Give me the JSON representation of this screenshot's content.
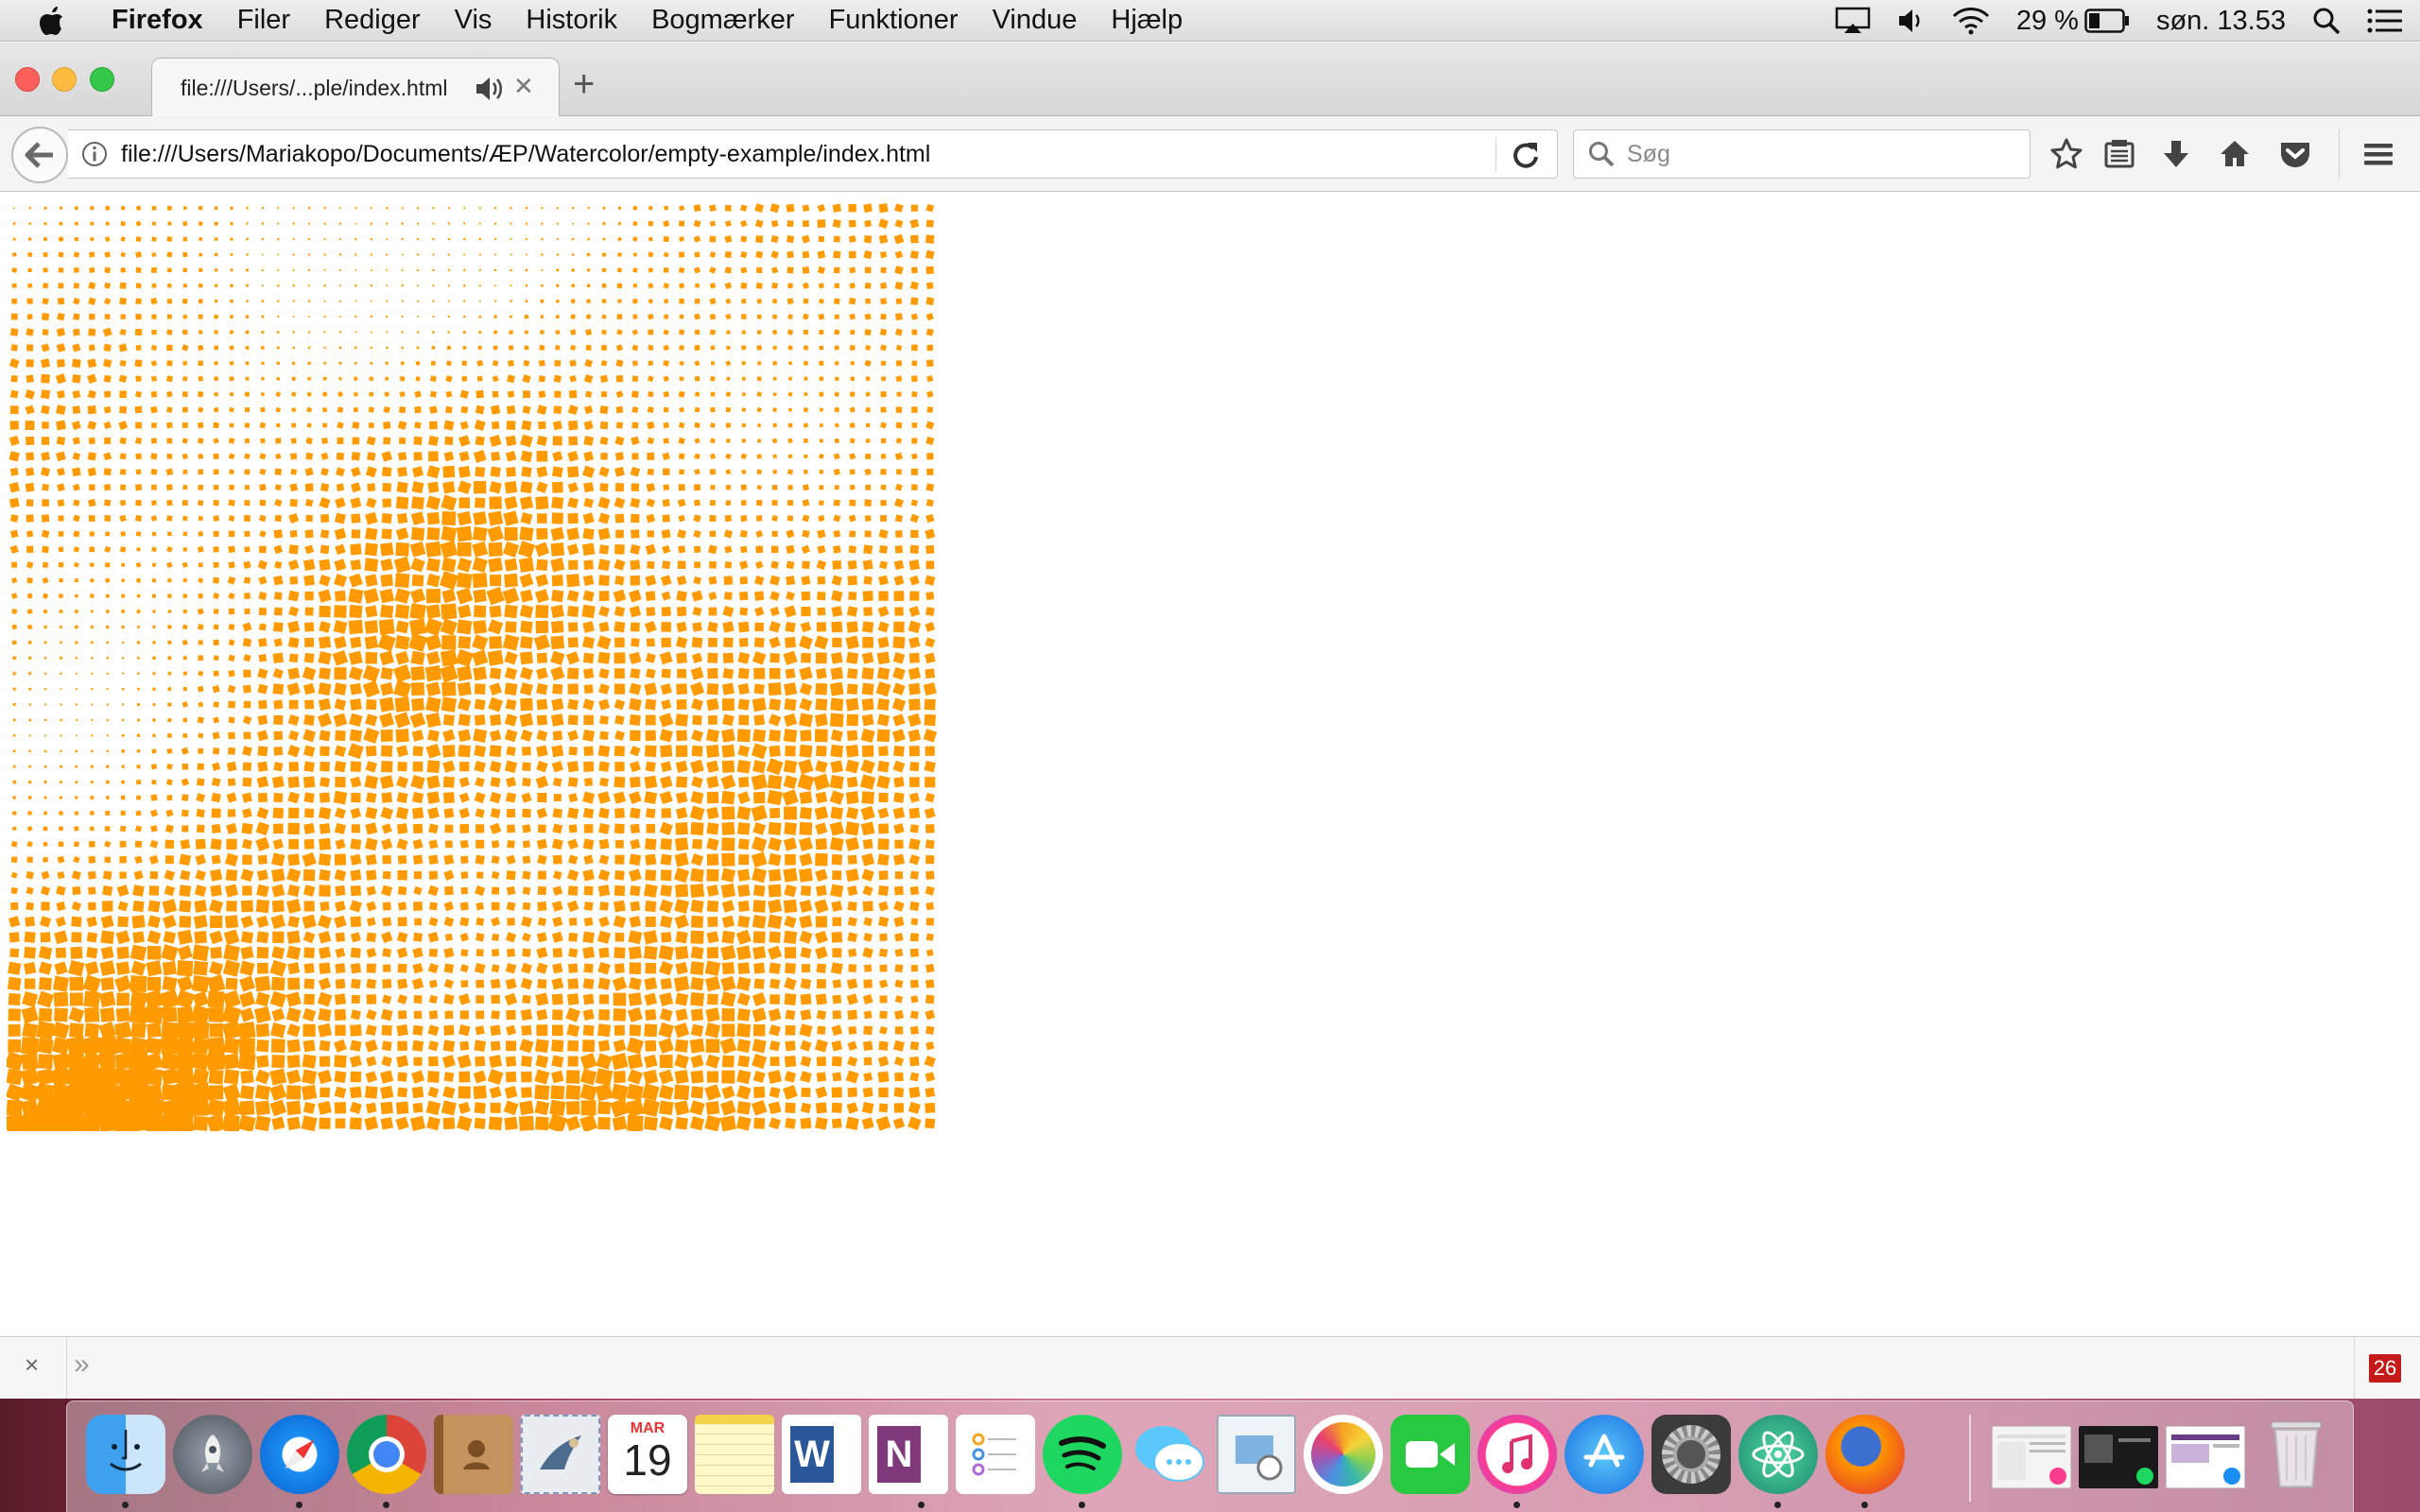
{
  "menubar": {
    "app_name": "Firefox",
    "items": [
      "Filer",
      "Rediger",
      "Vis",
      "Historik",
      "Bogmærker",
      "Funktioner",
      "Vindue",
      "Hjælp"
    ],
    "battery_text": "29 %",
    "clock": "søn. 13.53"
  },
  "tab": {
    "title": "file:///Users/...ple/index.html"
  },
  "urlbar": {
    "url": "file:///Users/Mariakopo/Documents/ÆP/Watercolor/empty-example/index.html"
  },
  "search": {
    "placeholder": "Søg"
  },
  "bottombar": {
    "close_glyph": "×",
    "chevron_glyph": "»",
    "badge_count": "26"
  },
  "canvas": {
    "fill_color": "#ff9a00",
    "background": "#ffffff"
  },
  "dock": {
    "calendar_month": "MAR",
    "calendar_day": "19",
    "apps": [
      "finder-icon",
      "launchpad-icon",
      "safari-icon",
      "chrome-icon",
      "contacts-icon",
      "mail-icon",
      "calendar-icon",
      "notes-icon",
      "word-icon",
      "onenote-icon",
      "reminders-icon",
      "spotify-icon",
      "messages-icon",
      "preview-icon",
      "photos-icon",
      "facetime-icon",
      "itunes-icon",
      "appstore-icon",
      "system-preferences-icon",
      "atom-icon",
      "firefox-icon",
      "window-thumbnail-icon",
      "window-thumbnail-icon",
      "window-thumbnail-icon",
      "trash-icon"
    ]
  }
}
